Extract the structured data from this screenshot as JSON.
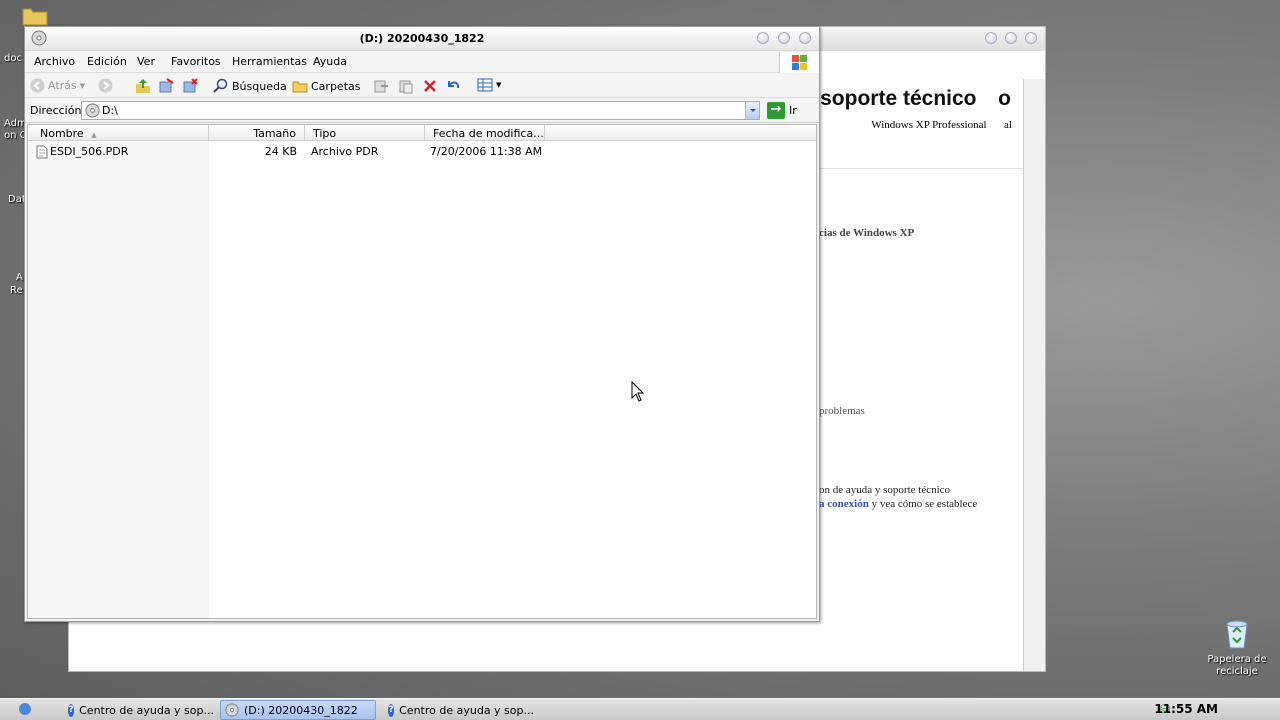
{
  "explorer": {
    "title": "(D:) 20200430_1822",
    "menu": [
      "Archivo",
      "Edición",
      "Ver",
      "Favoritos",
      "Herramientas",
      "Ayuda"
    ],
    "toolbar": {
      "back_label": "Atrás",
      "search_label": "Búsqueda",
      "folders_label": "Carpetas"
    },
    "address": {
      "label": "Dirección",
      "value": "D:\\",
      "go_label": "Ir"
    },
    "columns": [
      "Nombre",
      "Tamaño",
      "Tipo",
      "Fecha de modifica..."
    ],
    "files": [
      {
        "name": "ESDI_506.PDR",
        "size": "24 KB",
        "type": "Archivo PDR",
        "modified": "7/20/2006 11:38 AM"
      }
    ]
  },
  "help_window": {
    "heading": "a y soporte técnico",
    "heading_tail": "o",
    "subtitle": "Windows XP Professional",
    "subtitle_tail": "al",
    "line1": "cias de Windows XP",
    "line2": "problemas",
    "line3": "on de ayuda y soporte técnico",
    "line4_link": "a conexión",
    "line4_rest": " y vea cómo se establece"
  },
  "desktop": {
    "icon_fragments": [
      "doc",
      "Adm",
      "on C",
      "Dat",
      "A",
      "Re"
    ],
    "recycle_bin": "Papelera de reciclaje"
  },
  "taskbar": {
    "tasks": [
      {
        "label": "Centro de ayuda y sop...",
        "active": false
      },
      {
        "label": "(D:) 20200430_1822",
        "active": true
      },
      {
        "label": "Centro de ayuda y sop...",
        "active": false
      }
    ],
    "clock": "11:55 AM"
  },
  "colors": {
    "taskbar_active": "#a9c3ee",
    "go_button": "#2e9a35",
    "help_icon": "#2f62c8",
    "delete_icon": "#d2232a"
  }
}
